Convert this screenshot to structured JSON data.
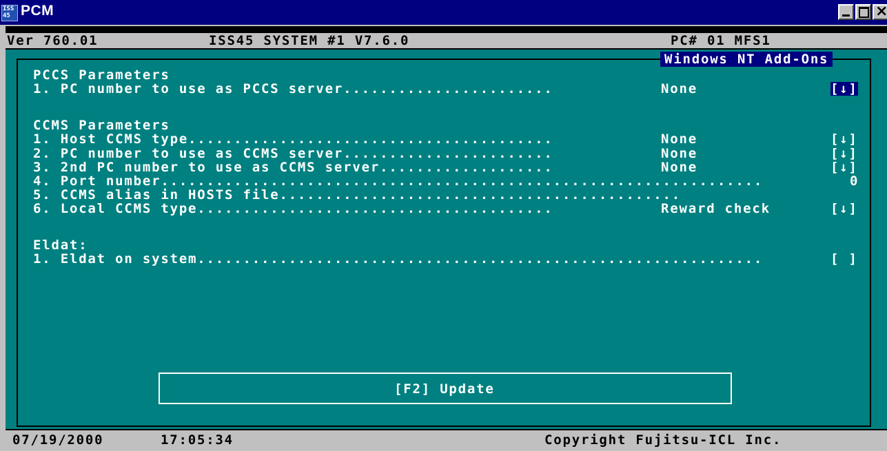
{
  "titlebar": {
    "title": "PCM",
    "icon_label_1": "ISS",
    "icon_label_2": "45"
  },
  "header": {
    "version": "Ver 760.01",
    "system": "ISS45 SYSTEM #1 V7.6.0",
    "pc": "PC# 01 MFS1"
  },
  "subtitle": "Windows NT Add-Ons",
  "pccs": {
    "heading": "PCCS Parameters",
    "items": [
      {
        "label": "1. PC number to use as PCCS server.......................",
        "value": "None",
        "control": "[↓]"
      }
    ]
  },
  "ccms": {
    "heading": "CCMS Parameters",
    "items": [
      {
        "label": "1. Host CCMS type........................................",
        "value": "None",
        "control": "[↓]"
      },
      {
        "label": "2. PC number to use as CCMS server.......................",
        "value": "None",
        "control": "[↓]"
      },
      {
        "label": "3. 2nd PC number to use as CCMS server...................",
        "value": "None",
        "control": "[↓]"
      },
      {
        "label": "4. Port number...................................................................",
        "value": "",
        "control": "0"
      },
      {
        "label": "5. CCMS alias in HOSTS file..............................................",
        "value": "",
        "control": ""
      },
      {
        "label": "6. Local CCMS type.......................................",
        "value": "Reward check",
        "control": "[↓]"
      }
    ]
  },
  "eldat": {
    "heading": "Eldat:",
    "items": [
      {
        "label": "1. Eldat on system...............................................................",
        "value": "",
        "control": "[ ]"
      }
    ]
  },
  "update_button": "[F2] Update",
  "status": {
    "date": "07/19/2000",
    "time": "17:05:34",
    "copyright": "Copyright Fujitsu-ICL Inc."
  }
}
